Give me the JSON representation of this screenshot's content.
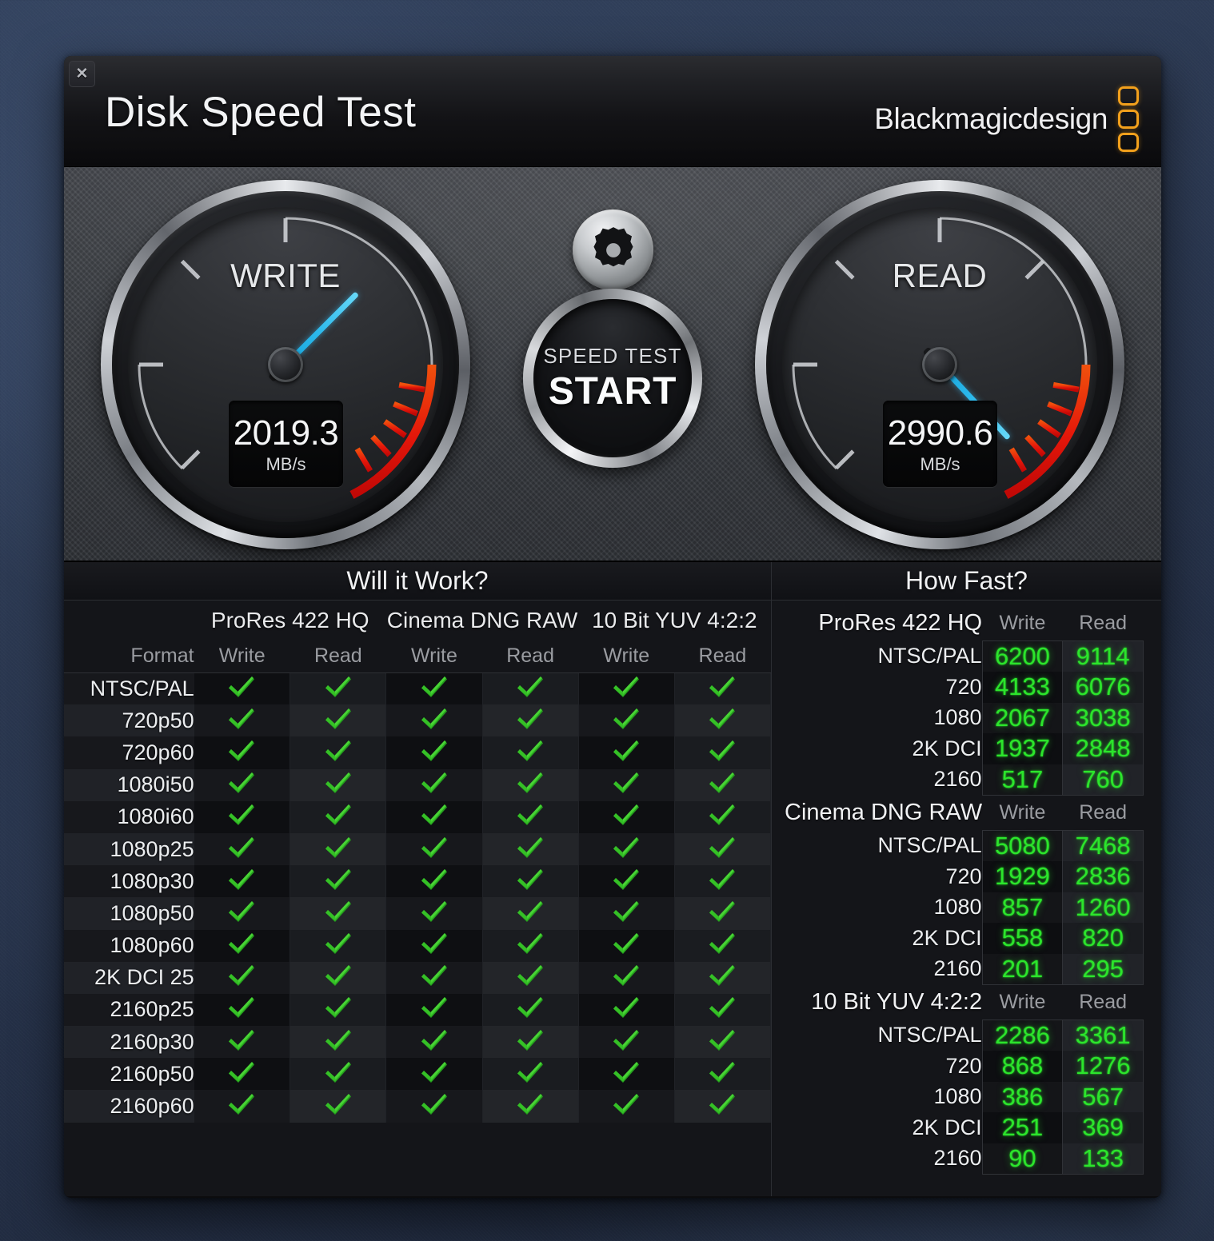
{
  "window": {
    "title": "Disk Speed Test",
    "close_label": "✕",
    "brand_name": "Blackmagicdesign"
  },
  "gauges": {
    "write": {
      "label": "WRITE",
      "value": "2019.3",
      "unit": "MB/s",
      "needle_angle_deg": 45
    },
    "read": {
      "label": "READ",
      "value": "2990.6",
      "unit": "MB/s",
      "needle_angle_deg": 137
    },
    "needle_color": "#2cb9ec",
    "redzone_color": "#e01b0c"
  },
  "controls": {
    "settings_icon": "gear-icon",
    "start_sub_label": "SPEED TEST",
    "start_main_label": "START"
  },
  "will_it_work": {
    "heading": "Will it Work?",
    "format_header": "Format",
    "codecs": [
      "ProRes 422 HQ",
      "Cinema DNG RAW",
      "10 Bit YUV 4:2:2"
    ],
    "sub_headers": [
      "Write",
      "Read"
    ],
    "formats": [
      "NTSC/PAL",
      "720p50",
      "720p60",
      "1080i50",
      "1080i60",
      "1080p25",
      "1080p30",
      "1080p50",
      "1080p60",
      "2K DCI 25",
      "2160p25",
      "2160p30",
      "2160p50",
      "2160p60"
    ],
    "results": [
      [
        "pass",
        "pass",
        "pass",
        "pass",
        "pass",
        "pass"
      ],
      [
        "pass",
        "pass",
        "pass",
        "pass",
        "pass",
        "pass"
      ],
      [
        "pass",
        "pass",
        "pass",
        "pass",
        "pass",
        "pass"
      ],
      [
        "pass",
        "pass",
        "pass",
        "pass",
        "pass",
        "pass"
      ],
      [
        "pass",
        "pass",
        "pass",
        "pass",
        "pass",
        "pass"
      ],
      [
        "pass",
        "pass",
        "pass",
        "pass",
        "pass",
        "pass"
      ],
      [
        "pass",
        "pass",
        "pass",
        "pass",
        "pass",
        "pass"
      ],
      [
        "pass",
        "pass",
        "pass",
        "pass",
        "pass",
        "pass"
      ],
      [
        "pass",
        "pass",
        "pass",
        "pass",
        "pass",
        "pass"
      ],
      [
        "pass",
        "pass",
        "pass",
        "pass",
        "pass",
        "pass"
      ],
      [
        "pass",
        "pass",
        "pass",
        "pass",
        "pass",
        "pass"
      ],
      [
        "pass",
        "pass",
        "pass",
        "pass",
        "pass",
        "pass"
      ],
      [
        "pass",
        "pass",
        "pass",
        "pass",
        "pass",
        "pass"
      ],
      [
        "pass",
        "pass",
        "pass",
        "pass",
        "pass",
        "pass"
      ]
    ],
    "pass_icon": "green-check-icon",
    "pass_color": "#2aa521"
  },
  "how_fast": {
    "heading": "How Fast?",
    "column_headers": [
      "Write",
      "Read"
    ],
    "value_color": "#2ce52c",
    "sections": [
      {
        "name": "ProRes 422 HQ",
        "rows": [
          {
            "format": "NTSC/PAL",
            "write": "6200",
            "read": "9114"
          },
          {
            "format": "720",
            "write": "4133",
            "read": "6076"
          },
          {
            "format": "1080",
            "write": "2067",
            "read": "3038"
          },
          {
            "format": "2K DCI",
            "write": "1937",
            "read": "2848"
          },
          {
            "format": "2160",
            "write": "517",
            "read": "760"
          }
        ]
      },
      {
        "name": "Cinema DNG RAW",
        "rows": [
          {
            "format": "NTSC/PAL",
            "write": "5080",
            "read": "7468"
          },
          {
            "format": "720",
            "write": "1929",
            "read": "2836"
          },
          {
            "format": "1080",
            "write": "857",
            "read": "1260"
          },
          {
            "format": "2K DCI",
            "write": "558",
            "read": "820"
          },
          {
            "format": "2160",
            "write": "201",
            "read": "295"
          }
        ]
      },
      {
        "name": "10 Bit YUV 4:2:2",
        "rows": [
          {
            "format": "NTSC/PAL",
            "write": "2286",
            "read": "3361"
          },
          {
            "format": "720",
            "write": "868",
            "read": "1276"
          },
          {
            "format": "1080",
            "write": "386",
            "read": "567"
          },
          {
            "format": "2K DCI",
            "write": "251",
            "read": "369"
          },
          {
            "format": "2160",
            "write": "90",
            "read": "133"
          }
        ]
      }
    ]
  }
}
